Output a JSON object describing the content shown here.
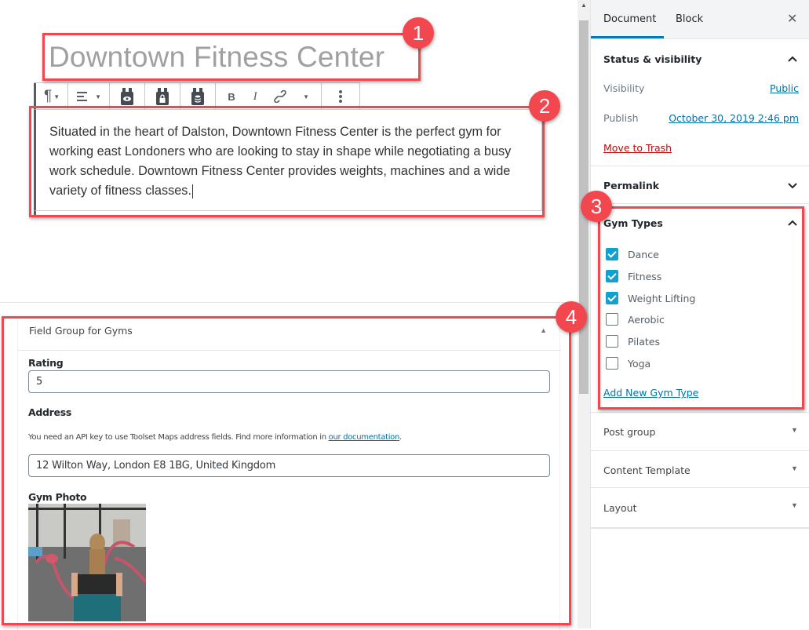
{
  "editor": {
    "post_title": "Downtown Fitness Center",
    "paragraph": "Situated in the heart of Dalston, Downtown Fitness Center is the perfect gym for working east Londoners who are looking to stay in shape while negotiating a busy work schedule. Downtown Fitness Center provides weights, machines and a wide variety of fitness classes.",
    "toolbar": {
      "paragraph_icon": "¶",
      "align_icon": "align-left-icon",
      "bold": "B",
      "italic": "I",
      "link_icon": "link-icon",
      "more_icon": "⋮"
    }
  },
  "annotations": [
    "1",
    "2",
    "3",
    "4"
  ],
  "field_group": {
    "title": "Field Group for Gyms",
    "rating_label": "Rating",
    "rating_value": "5",
    "address_label": "Address",
    "help_text": "You need an API key to use Toolset Maps address fields. Find more information in ",
    "help_link": "our documentation",
    "help_end": ".",
    "address_value": "12 Wilton Way, London E8 1BG, United Kingdom",
    "photo_label": "Gym Photo"
  },
  "sidebar": {
    "tabs": [
      {
        "label": "Document",
        "active": true
      },
      {
        "label": "Block",
        "active": false
      }
    ],
    "close_icon": "✕",
    "status": {
      "title": "Status & visibility",
      "visibility_label": "Visibility",
      "visibility_value": "Public",
      "publish_label": "Publish",
      "publish_value": "October 30, 2019 2:46 pm",
      "trash": "Move to Trash"
    },
    "permalink": "Permalink",
    "gym_types": {
      "title": "Gym Types",
      "items": [
        {
          "label": "Dance",
          "checked": true
        },
        {
          "label": "Fitness",
          "checked": true
        },
        {
          "label": "Weight Lifting",
          "checked": true
        },
        {
          "label": "Aerobic",
          "checked": false
        },
        {
          "label": "Pilates",
          "checked": false
        },
        {
          "label": "Yoga",
          "checked": false
        }
      ],
      "add_new": "Add New Gym Type"
    },
    "post_group": "Post group",
    "content_template": "Content Template",
    "layout": "Layout"
  },
  "colors": {
    "accent": "#007cba",
    "annotation": "#f2474f",
    "checkbox": "#11a0d2",
    "trash": "#bc0b0b"
  }
}
